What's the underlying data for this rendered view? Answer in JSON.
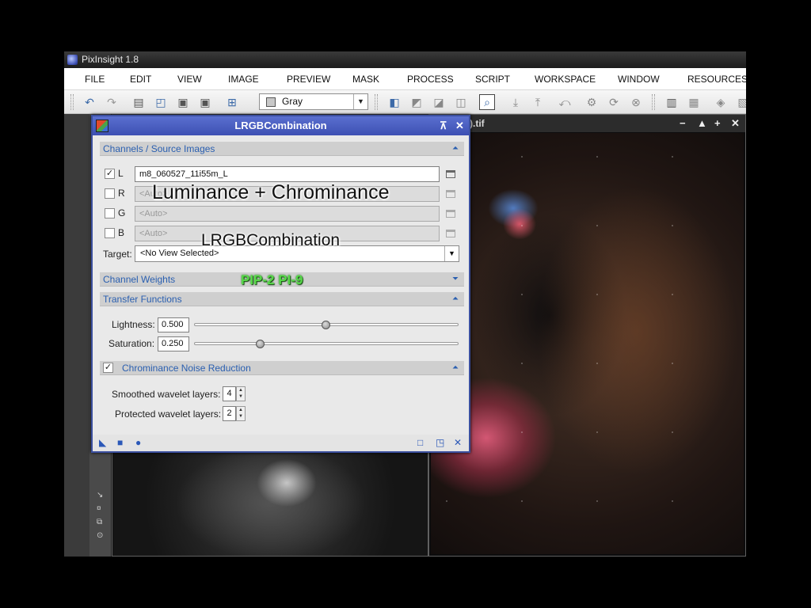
{
  "app": {
    "title": "PixInsight 1.8"
  },
  "menu": [
    "FILE",
    "EDIT",
    "VIEW",
    "IMAGE",
    "PREVIEW",
    "MASK",
    "PROCESS",
    "SCRIPT",
    "WORKSPACE",
    "WINDOW",
    "RESOURCES"
  ],
  "toolbar": {
    "color_space": "Gray"
  },
  "color_window": {
    "title_fragment": ").tif",
    "controls": [
      "−",
      "▲",
      "+",
      "✕"
    ]
  },
  "dialog": {
    "title": "LRGBCombination",
    "channels": {
      "header": "Channels / Source Images",
      "rows": [
        {
          "label": "L",
          "checked": true,
          "value": "m8_060527_11i55m_L"
        },
        {
          "label": "R",
          "checked": false,
          "value": "<Auto>"
        },
        {
          "label": "G",
          "checked": false,
          "value": "<Auto>"
        },
        {
          "label": "B",
          "checked": false,
          "value": "<Auto>"
        }
      ],
      "target_label": "Target:",
      "target_value": "<No View Selected>"
    },
    "channel_weights": {
      "header": "Channel Weights"
    },
    "transfer": {
      "header": "Transfer Functions",
      "lightness_label": "Lightness:",
      "lightness_value": "0.500",
      "lightness_level": 0.5,
      "saturation_label": "Saturation:",
      "saturation_value": "0.250",
      "saturation_level": 0.25
    },
    "noise": {
      "header": "Chrominance Noise Reduction",
      "checked": true,
      "smoothed_label": "Smoothed wavelet layers:",
      "smoothed_value": "4",
      "protected_label": "Protected wavelet layers:",
      "protected_value": "2"
    }
  },
  "overlays": {
    "luminance": "Luminance + Chrominance",
    "lrgb": "LRGBCombination",
    "pip": "PIP-2 PI-9"
  },
  "colors": {
    "dialog_title": "#3d50b3",
    "section_text": "#2a5fb0",
    "pip_text": "#58d94a"
  }
}
